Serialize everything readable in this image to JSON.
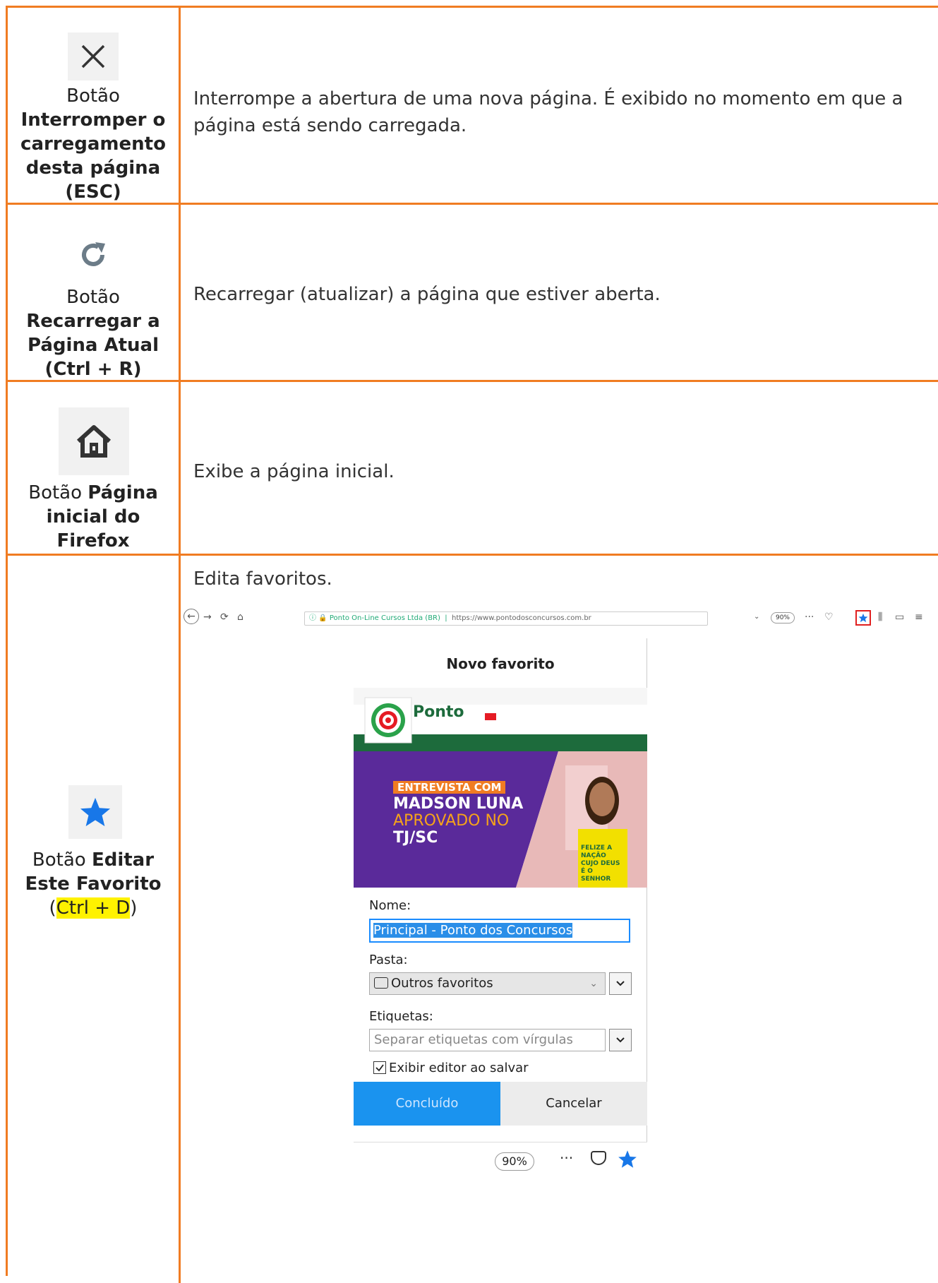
{
  "rows": [
    {
      "icon": "close-icon",
      "label_pre": "Botão",
      "label_bold": "Interromper o carregamento desta página (ESC)",
      "description": "Interrompe a abertura de uma nova página. É exibido no momento em que a página está sendo carregada."
    },
    {
      "icon": "reload-icon",
      "label_pre": "Botão",
      "label_bold": "Recarregar a Página Atual (Ctrl + R)",
      "description": "Recarregar (atualizar) a página que estiver aberta."
    },
    {
      "icon": "home-icon",
      "label_pre": "Botão",
      "label_bold": "Página inicial do Firefox",
      "description": "Exibe a página inicial."
    },
    {
      "icon": "star-icon",
      "label_pre": "Botão",
      "label_bold": "Editar Este Favorito",
      "shortcut": "Ctrl + D",
      "description": "Edita favoritos."
    }
  ],
  "screenshot": {
    "site_identity": "Ponto On-Line Cursos Ltda (BR)",
    "url": "https://www.pontodosconcursos.com.br",
    "zoom": "90%",
    "popup_title": "Novo favorito",
    "name_label": "Nome:",
    "name_value": "Principal - Ponto dos Concursos",
    "folder_label": "Pasta:",
    "folder_value": "Outros favoritos",
    "tags_label": "Etiquetas:",
    "tags_placeholder": "Separar etiquetas com vírgulas",
    "show_editor_label": "Exibir editor ao salvar",
    "done_button": "Concluído",
    "cancel_button": "Cancelar",
    "banner_line1": "ENTREVISTA COM",
    "banner_line2": "MADSON LUNA",
    "banner_line3": "APROVADO NO",
    "banner_line4": "TJ/SC",
    "site_logo": "Ponto",
    "shirt_text": "FELIZE A NAÇÃO CUJO DEUS É O SENHOR"
  }
}
